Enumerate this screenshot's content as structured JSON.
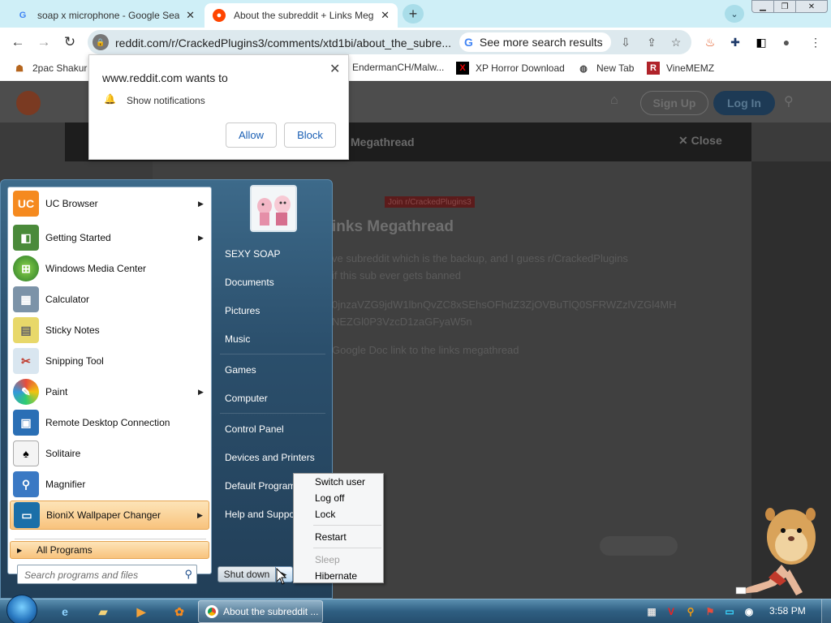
{
  "browser": {
    "tabs": [
      {
        "title": "soap x microphone - Google Sea",
        "favicon": "google-icon",
        "active": false
      },
      {
        "title": "About the subreddit + Links Meg",
        "favicon": "reddit-icon",
        "active": true
      }
    ],
    "address": "reddit.com/r/CrackedPlugins3/comments/xtd1bi/about_the_subre...",
    "see_more": "See more search results",
    "bookmarks": [
      {
        "label": "2pac Shakur -",
        "icon": "person-icon"
      },
      {
        "label": "EndermanCH/Malw...",
        "icon": "github-icon"
      },
      {
        "label": "XP Horror Download",
        "icon": "x-icon"
      },
      {
        "label": "New Tab",
        "icon": "globe-icon"
      },
      {
        "label": "VineMEMZ",
        "icon": "r-icon"
      }
    ]
  },
  "notification": {
    "title": "www.reddit.com wants to",
    "text": "Show notifications",
    "allow": "Allow",
    "block": "Block"
  },
  "reddit": {
    "signup": "Sign Up",
    "login": "Log In",
    "thread_bar": "Megathread",
    "close": "Close",
    "join_badge": "Join r/CrackedPlugins3",
    "heading": "inks Megathread",
    "lines": [
      "ve subreddit which is the backup, and I guess r/CrackedPlugins",
      "if this sub ever gets banned",
      "0jnzaVZG9jdW1lbnQvZC8xSEhsOFhdZ3ZjOVBuTlQ0SFRWZzlVZGl4MH",
      "NEZGl0P3VzcD1zaGFyaW5n",
      "Google Doc link to the links megathread"
    ]
  },
  "startmenu": {
    "programs": [
      {
        "label": "UC Browser",
        "icon": "uc-browser-icon",
        "submenu": true,
        "highlight": false
      },
      {
        "label": "Getting Started",
        "icon": "getting-started-icon",
        "submenu": true,
        "highlight": false
      },
      {
        "label": "Windows Media Center",
        "icon": "media-center-icon",
        "submenu": false,
        "highlight": false
      },
      {
        "label": "Calculator",
        "icon": "calculator-icon",
        "submenu": false,
        "highlight": false
      },
      {
        "label": "Sticky Notes",
        "icon": "sticky-notes-icon",
        "submenu": false,
        "highlight": false
      },
      {
        "label": "Snipping Tool",
        "icon": "snipping-tool-icon",
        "submenu": false,
        "highlight": false
      },
      {
        "label": "Paint",
        "icon": "paint-icon",
        "submenu": true,
        "highlight": false
      },
      {
        "label": "Remote Desktop Connection",
        "icon": "remote-desktop-icon",
        "submenu": false,
        "highlight": false
      },
      {
        "label": "Solitaire",
        "icon": "solitaire-icon",
        "submenu": false,
        "highlight": false
      },
      {
        "label": "Magnifier",
        "icon": "magnifier-icon",
        "submenu": false,
        "highlight": false
      },
      {
        "label": "BioniX Wallpaper Changer",
        "icon": "wallpaper-changer-icon",
        "submenu": true,
        "highlight": true
      }
    ],
    "all_programs": "All Programs",
    "search_placeholder": "Search programs and files",
    "right_links": [
      "SEXY SOAP",
      "Documents",
      "Pictures",
      "Music",
      "Games",
      "Computer",
      "Control Panel",
      "Devices and Printers",
      "Default Programs",
      "Help and Support"
    ],
    "shutdown": "Shut down",
    "power_menu": [
      "Switch user",
      "Log off",
      "Lock",
      "Restart",
      "Sleep",
      "Hibernate"
    ]
  },
  "taskbar": {
    "active_task": "About the subreddit ...",
    "clock": "3:58 PM"
  }
}
